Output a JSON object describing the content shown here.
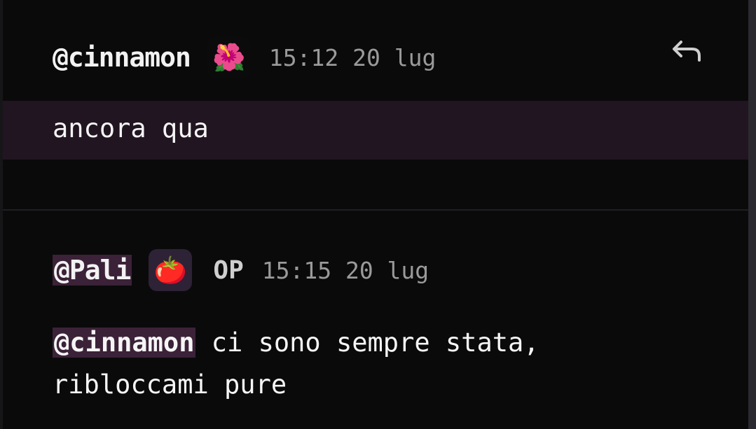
{
  "posts": [
    {
      "username": "@cinnamon",
      "avatar_icon": "hibiscus-icon",
      "avatar_glyph": "🌺",
      "timestamp": "15:12 20 lug",
      "message": "ancora qua",
      "reply_icon": "reply-arrow-icon"
    },
    {
      "username": "@Pali",
      "avatar_icon": "tomato-icon",
      "avatar_glyph": "🍅",
      "badge": "OP",
      "timestamp": "15:15 20 lug",
      "mention": "@cinnamon",
      "message_line1": " ci sono sempre stata,",
      "message_line2": "ribloccami pure"
    }
  ],
  "colors": {
    "background": "#0a0a0a",
    "highlight_row": "#211522",
    "mention_bg": "#3b2238",
    "timestamp": "#9a9a9a"
  }
}
